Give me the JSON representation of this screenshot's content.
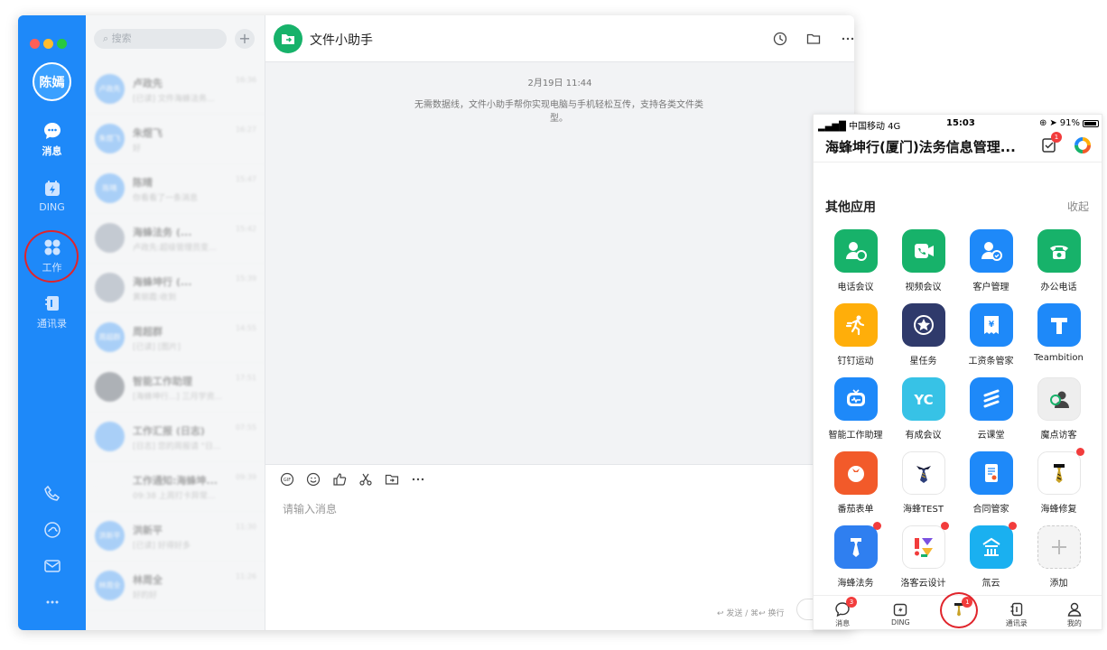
{
  "window_controls": {
    "close": "#fe5f57",
    "minimize": "#febc2e",
    "maximize": "#28c840"
  },
  "rail": {
    "avatar_text": "陈嫣",
    "items": [
      {
        "label": "消息",
        "icon": "chat-bubble-icon",
        "active": true
      },
      {
        "label": "DING",
        "icon": "ding-icon",
        "active": false
      },
      {
        "label": "工作",
        "icon": "apps-grid-icon",
        "active": false
      },
      {
        "label": "通讯录",
        "icon": "contacts-book-icon",
        "active": false
      }
    ],
    "bottom_icons": [
      "phone-icon",
      "cloud-icon",
      "mail-icon",
      "more-icon"
    ],
    "accent": "#1e89f9"
  },
  "conversations": {
    "search_placeholder": "搜索",
    "items": [
      {
        "name": "卢政先",
        "preview": "[已读] 文件海蜂法务...",
        "time": "16:36",
        "avatar": "卢政先"
      },
      {
        "name": "朱煜飞",
        "preview": "好",
        "time": "16:27",
        "avatar": "朱煜飞"
      },
      {
        "name": "陈晴",
        "preview": "你看看了一条消息",
        "time": "15:47",
        "avatar": "陈晴"
      },
      {
        "name": "海蜂法务 (...",
        "preview": "卢政先:超级管理员变...",
        "time": "15:42",
        "avatar": ""
      },
      {
        "name": "海蜂坤行 (...",
        "preview": "黄丽霞:收到",
        "time": "15:39",
        "avatar": ""
      },
      {
        "name": "周超群",
        "preview": "[已读] [图片]",
        "time": "14:55",
        "avatar": "周超群"
      },
      {
        "name": "智能工作助理",
        "preview": "[海蜂坤行...] 三月学资...",
        "time": "17:51",
        "avatar": ""
      },
      {
        "name": "工作汇报 (日志)",
        "preview": "[日志] 您的周报请 \"日...",
        "time": "07:55",
        "avatar": ""
      },
      {
        "name": "工作通知:海蜂坤...",
        "preview": "09:38 上周打卡异常...",
        "time": "09:39",
        "avatar": ""
      },
      {
        "name": "洪新平",
        "preview": "[已读] 好得好多",
        "time": "11:30",
        "avatar": "洪新平"
      },
      {
        "name": "林周全",
        "preview": "好的好",
        "time": "11:26",
        "avatar": "林周全"
      }
    ]
  },
  "chat": {
    "title": "文件小助手",
    "header_icons": [
      "history-clock-icon",
      "folder-icon",
      "more-icon"
    ],
    "date": "2月19日 11:44",
    "system_message": "无需数据线，文件小助手帮你实现电脑与手机轻松互传，支持各类文件类型。",
    "toolbar_icons": [
      "gif-icon",
      "emoji-icon",
      "thumbs-up-icon",
      "scissors-icon",
      "forward-folder-icon",
      "more-icon"
    ],
    "input_placeholder": "请输入消息",
    "send_hint": "↩ 发送 / ⌘↩ 换行"
  },
  "phone": {
    "carrier": "中国移动",
    "network": "4G",
    "time": "15:03",
    "battery": "91%",
    "battery_level": 0.91,
    "title": "海蜂坤行(厦门)法务信息管理...",
    "header_badge": "1",
    "section_title": "其他应用",
    "collapse_label": "收起",
    "apps": [
      {
        "label": "电话会议",
        "icon": "conference-call-icon",
        "color": "#17b26a",
        "dot": false
      },
      {
        "label": "视频会议",
        "icon": "video-call-icon",
        "color": "#17b26a",
        "dot": false
      },
      {
        "label": "客户管理",
        "icon": "customer-icon",
        "color": "#1e89f9",
        "dot": false
      },
      {
        "label": "办公电话",
        "icon": "office-phone-icon",
        "color": "#17b26a",
        "dot": false
      },
      {
        "label": "钉钉运动",
        "icon": "running-icon",
        "color": "#ffae0a",
        "dot": false
      },
      {
        "label": "星任务",
        "icon": "star-task-icon",
        "color": "#2f3a6b",
        "dot": false
      },
      {
        "label": "工资条管家",
        "icon": "salary-icon",
        "color": "#1e89f9",
        "dot": false
      },
      {
        "label": "Teambition",
        "icon": "teambition-icon",
        "color": "#1e89f9",
        "dot": false
      },
      {
        "label": "智能工作助理",
        "icon": "robot-icon",
        "color": "#1e89f9",
        "dot": false
      },
      {
        "label": "有成会议",
        "icon": "youcheng-icon",
        "color": "#37c2e6",
        "dot": false
      },
      {
        "label": "云课堂",
        "icon": "cloud-class-icon",
        "color": "#1e89f9",
        "dot": false
      },
      {
        "label": "魔点访客",
        "icon": "visitor-icon",
        "color": "#eeeeee",
        "dot": false
      },
      {
        "label": "番茄表单",
        "icon": "tomato-form-icon",
        "color": "#f25a2a",
        "dot": false
      },
      {
        "label": "海蜂TEST",
        "icon": "haifeng-test-icon",
        "color": "#ffffff",
        "dot": false
      },
      {
        "label": "合同管家",
        "icon": "contract-icon",
        "color": "#1e89f9",
        "dot": false
      },
      {
        "label": "海蜂修复",
        "icon": "haifeng-fix-icon",
        "color": "#ffffff",
        "dot": true
      },
      {
        "label": "海蜂法务",
        "icon": "haifeng-legal-icon",
        "color": "#2f7ff0",
        "dot": true
      },
      {
        "label": "洛客云设计",
        "icon": "luoke-design-icon",
        "color": "#ffffff",
        "dot": true
      },
      {
        "label": "氚云",
        "icon": "chuanyun-icon",
        "color": "#1ab0f0",
        "dot": true
      },
      {
        "label": "添加",
        "icon": "add-icon",
        "color": "#f4f4f4",
        "dot": false
      }
    ],
    "tabs": [
      {
        "label": "消息",
        "icon": "chat-bubble-icon",
        "badge": "3"
      },
      {
        "label": "DING",
        "icon": "ding-icon",
        "badge": ""
      },
      {
        "label": "",
        "icon": "haifeng-tie-icon",
        "badge": "1"
      },
      {
        "label": "通讯录",
        "icon": "contacts-book-icon",
        "badge": ""
      },
      {
        "label": "我的",
        "icon": "profile-icon",
        "badge": ""
      }
    ]
  }
}
